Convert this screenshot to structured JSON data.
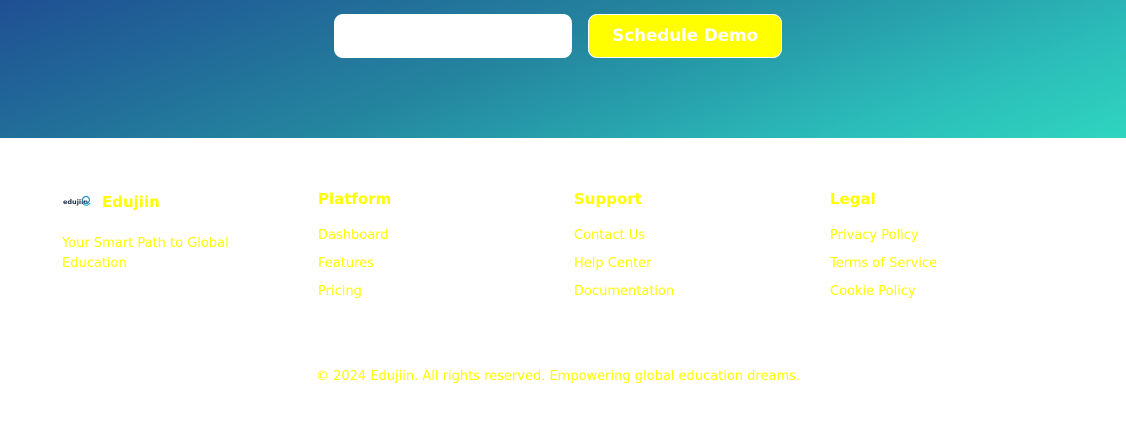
{
  "cta": {
    "input_placeholder": "",
    "button_label": "Schedule Demo"
  },
  "brand": {
    "logo_text": "edujiin",
    "name": "Edujiin",
    "tagline": "Your Smart Path to Global Education"
  },
  "columns": {
    "platform": {
      "title": "Platform",
      "links": [
        "Dashboard",
        "Features",
        "Pricing"
      ]
    },
    "support": {
      "title": "Support",
      "links": [
        "Contact Us",
        "Help Center",
        "Documentation"
      ]
    },
    "legal": {
      "title": "Legal",
      "links": [
        "Privacy Policy",
        "Terms of Service",
        "Cookie Policy"
      ]
    }
  },
  "copyright": "© 2024 Edujiin. All rights reserved. Empowering global education dreams.",
  "colors": {
    "accent": "#ffff00",
    "gradient_start": "#1f4f93",
    "gradient_end": "#2fd5bf"
  }
}
